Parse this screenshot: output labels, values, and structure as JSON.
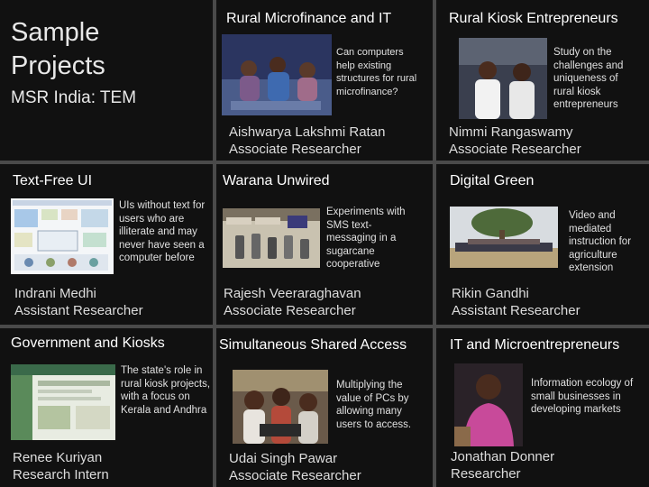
{
  "header": {
    "title_line1": "Sample",
    "title_line2": "Projects",
    "subtitle": "MSR India: TEM"
  },
  "projects": [
    {
      "title": "Rural Microfinance and IT",
      "description": "Can computers help existing structures for rural microfinance?",
      "person": "Aishwarya Lakshmi Ratan",
      "role": "Associate Researcher"
    },
    {
      "title": "Rural Kiosk Entrepreneurs",
      "description": "Study on the challenges and uniqueness of rural kiosk entrepreneurs",
      "person": "Nimmi Rangaswamy",
      "role": "Associate Researcher"
    },
    {
      "title": "Text-Free UI",
      "description": "UIs without text for users who are illiterate and may never have seen a computer before",
      "person": "Indrani Medhi",
      "role": "Assistant Researcher"
    },
    {
      "title": "Warana Unwired",
      "description": "Experiments with SMS text-messaging in a sugarcane cooperative",
      "person": "Rajesh Veeraraghavan",
      "role": "Associate Researcher"
    },
    {
      "title": "Digital Green",
      "description": "Video and mediated instruction for agriculture extension",
      "person": "Rikin Gandhi",
      "role": "Assistant Researcher"
    },
    {
      "title": "Government and Kiosks",
      "description": "The state's role in rural kiosk projects, with a focus on Kerala and Andhra",
      "person": "Renee Kuriyan",
      "role": "Research Intern"
    },
    {
      "title": "Simultaneous Shared Access",
      "description": "Multiplying the value of PCs by allowing many users to access.",
      "person": "Udai Singh Pawar",
      "role": "Associate Researcher"
    },
    {
      "title": "IT and Microentrepreneurs",
      "description": "Information ecology of small businesses in developing markets",
      "person": "Jonathan Donner",
      "role": "Researcher"
    }
  ]
}
